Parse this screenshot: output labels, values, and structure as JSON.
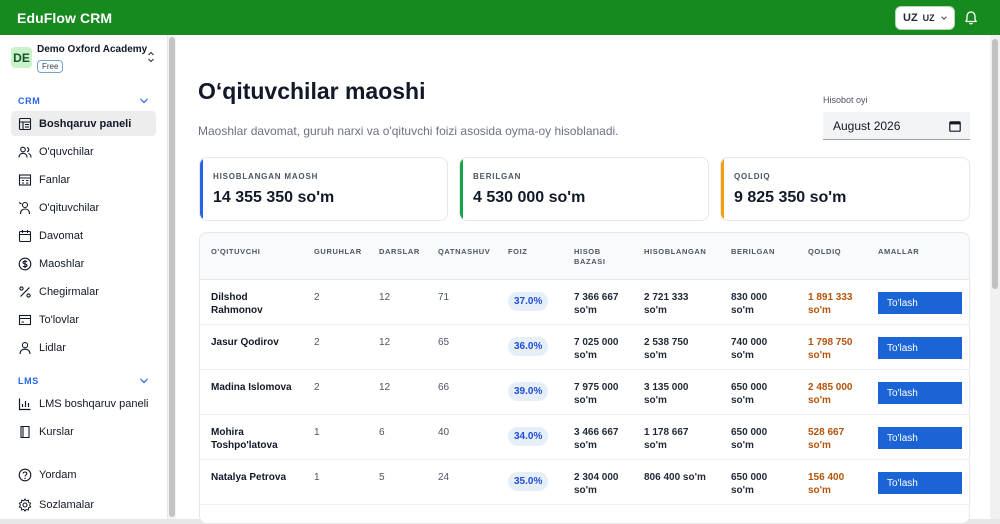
{
  "app": {
    "title": "EduFlow CRM"
  },
  "header": {
    "lang_code": "UZ",
    "lang_value": "UZ"
  },
  "org": {
    "initials": "DE",
    "name": "Demo Oxford Academy",
    "plan": "Free"
  },
  "sidebar": {
    "crm_label": "CRM",
    "crm_items": [
      {
        "label": "Boshqaruv paneli",
        "icon": "dashboard-icon"
      },
      {
        "label": "O'quvchilar",
        "icon": "users-icon"
      },
      {
        "label": "Fanlar",
        "icon": "book-icon"
      },
      {
        "label": "O'qituvchilar",
        "icon": "teacher-icon"
      },
      {
        "label": "Davomat",
        "icon": "calendar-icon"
      },
      {
        "label": "Maoshlar",
        "icon": "dollar-icon"
      },
      {
        "label": "Chegirmalar",
        "icon": "percent-icon"
      },
      {
        "label": "To'lovlar",
        "icon": "payments-icon"
      },
      {
        "label": "Lidlar",
        "icon": "leads-icon"
      }
    ],
    "lms_label": "LMS",
    "lms_items": [
      {
        "label": "LMS boshqaruv paneli",
        "icon": "chart-icon"
      },
      {
        "label": "Kurslar",
        "icon": "course-icon"
      }
    ],
    "bottom_items": [
      {
        "label": "Yordam",
        "icon": "help-icon"
      },
      {
        "label": "Sozlamalar",
        "icon": "settings-icon"
      }
    ]
  },
  "page": {
    "title": "O‘qituvchilar maoshi",
    "subtitle": "Maoshlar davomat, guruh narxi va o'qituvchi foizi asosida oyma-oy hisoblanadi.",
    "month_label": "Hisobot oyi",
    "month_value": "August 2026"
  },
  "summary": [
    {
      "label": "HISOBLANGAN MAOSH",
      "value": "14 355 350 so'm",
      "color": "#2563eb"
    },
    {
      "label": "BERILGAN",
      "value": "4 530 000 so'm",
      "color": "#16a34a"
    },
    {
      "label": "QOLDIQ",
      "value": "9 825 350 so'm",
      "color": "#f59e0b"
    }
  ],
  "table": {
    "headers": {
      "teacher": "O'QITUVCHI",
      "groups": "GURUHLAR",
      "lessons": "DARSLAR",
      "attendance": "QATNASHUV",
      "percent": "FOIZ",
      "base_1": "HISOB",
      "base_2": "BAZASI",
      "calculated": "HISOBLANGAN",
      "paid": "BERILGAN",
      "remaining": "QOLDIQ",
      "actions": "AMALLAR"
    },
    "rows": [
      {
        "name1": "Dilshod",
        "name2": "Rahmonov",
        "groups": "2",
        "lessons": "12",
        "attendance": "71",
        "percent": "37.0%",
        "base1": "7 366 667",
        "base2": "so'm",
        "calc1": "2 721 333",
        "calc2": "so'm",
        "paid1": "830 000",
        "paid2": "so'm",
        "rem1": "1 891 333",
        "rem2": "so'm",
        "action": "To'lash"
      },
      {
        "name1": "Jasur Qodirov",
        "name2": "",
        "groups": "2",
        "lessons": "12",
        "attendance": "65",
        "percent": "36.0%",
        "base1": "7 025 000",
        "base2": "so'm",
        "calc1": "2 538 750",
        "calc2": "so'm",
        "paid1": "740 000",
        "paid2": "so'm",
        "rem1": "1 798 750",
        "rem2": "so'm",
        "action": "To'lash"
      },
      {
        "name1": "Madina Islomova",
        "name2": "",
        "groups": "2",
        "lessons": "12",
        "attendance": "66",
        "percent": "39.0%",
        "base1": "7 975 000",
        "base2": "so'm",
        "calc1": "3 135 000",
        "calc2": "so'm",
        "paid1": "650 000",
        "paid2": "so'm",
        "rem1": "2 485 000",
        "rem2": "so'm",
        "action": "To'lash"
      },
      {
        "name1": "Mohira",
        "name2": "Toshpo'latova",
        "groups": "1",
        "lessons": "6",
        "attendance": "40",
        "percent": "34.0%",
        "base1": "3 466 667",
        "base2": "so'm",
        "calc1": "1 178 667",
        "calc2": "so'm",
        "paid1": "650 000",
        "paid2": "so'm",
        "rem1": "528 667",
        "rem2": "so'm",
        "action": "To'lash"
      },
      {
        "name1": "Natalya Petrova",
        "name2": "",
        "groups": "1",
        "lessons": "5",
        "attendance": "24",
        "percent": "35.0%",
        "base1": "2 304 000",
        "base2": "so'm",
        "calc1": "806 400 so'm",
        "calc2": "",
        "paid1": "650 000",
        "paid2": "so'm",
        "rem1": "156 400",
        "rem2": "so'm",
        "action": "To'lash"
      }
    ]
  }
}
